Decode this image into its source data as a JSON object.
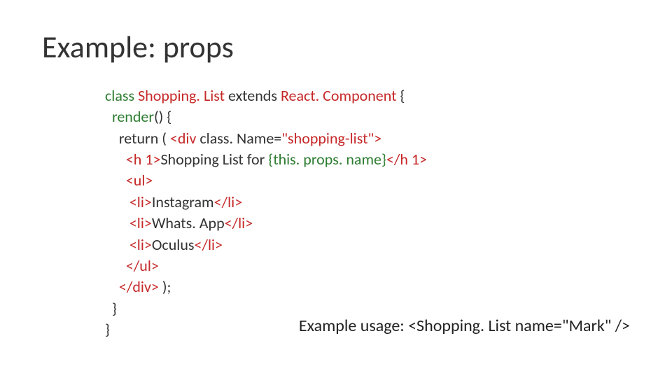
{
  "title": "Example: props",
  "code": {
    "l1_class": "class ",
    "l1_name": "Shopping. List ",
    "l1_extends": "extends ",
    "l1_comp": "React. Component ",
    "l1_brace": "{",
    "l2_render": "render",
    "l2_rest": "() {",
    "l3_return": "return ( ",
    "l3_open": "<div ",
    "l3_attr": "class. Name",
    "l3_eq": "=",
    "l3_str": "\"shopping-list\"",
    "l3_close": ">",
    "l4_open": "<h 1>",
    "l4_text": "Shopping List for ",
    "l4_expr": "{this. props. name}",
    "l4_close": "</h 1>",
    "l5": "<ul>",
    "l6_open": "<li>",
    "l6_text": "Instagram",
    "l6_close": "</li>",
    "l7_open": "<li>",
    "l7_text": "Whats. App",
    "l7_close": "</li>",
    "l8_open": "<li>",
    "l8_text": "Oculus",
    "l8_close": "</li>",
    "l9": "</ul>",
    "l10": "</div>",
    "l10_rest": " );",
    "l11": "}",
    "l12": "}"
  },
  "usage": "Example usage: <Shopping. List name=\"Mark\" />"
}
